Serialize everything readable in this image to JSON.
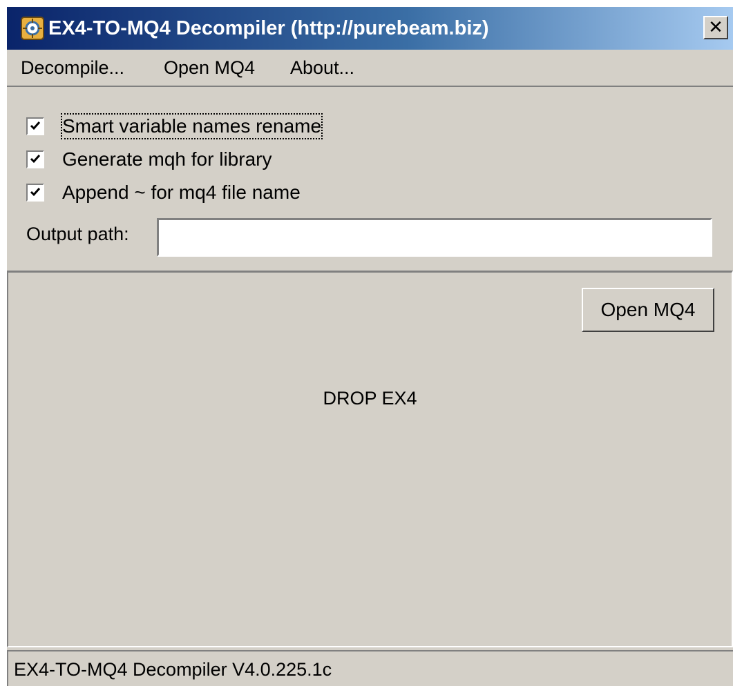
{
  "window": {
    "title": "EX4-TO-MQ4 Decompiler (http://purebeam.biz)",
    "close_label": "✕"
  },
  "menu": {
    "items": [
      {
        "label": "Decompile..."
      },
      {
        "label": "Open MQ4"
      },
      {
        "label": "About..."
      }
    ]
  },
  "options": {
    "checkboxes": [
      {
        "label": "Smart variable names rename",
        "checked": true
      },
      {
        "label": "Generate mqh for library",
        "checked": true
      },
      {
        "label": "Append ~ for mq4 file name",
        "checked": true
      }
    ],
    "output_path_label": "Output path:",
    "output_path_value": ""
  },
  "drop_area": {
    "open_button_label": "Open MQ4",
    "drop_text": "DROP EX4"
  },
  "status": {
    "text": "EX4-TO-MQ4 Decompiler V4.0.225.1c"
  },
  "colors": {
    "face": "#d4d0c8",
    "title_start": "#0a246a",
    "title_end": "#a6caf0"
  }
}
